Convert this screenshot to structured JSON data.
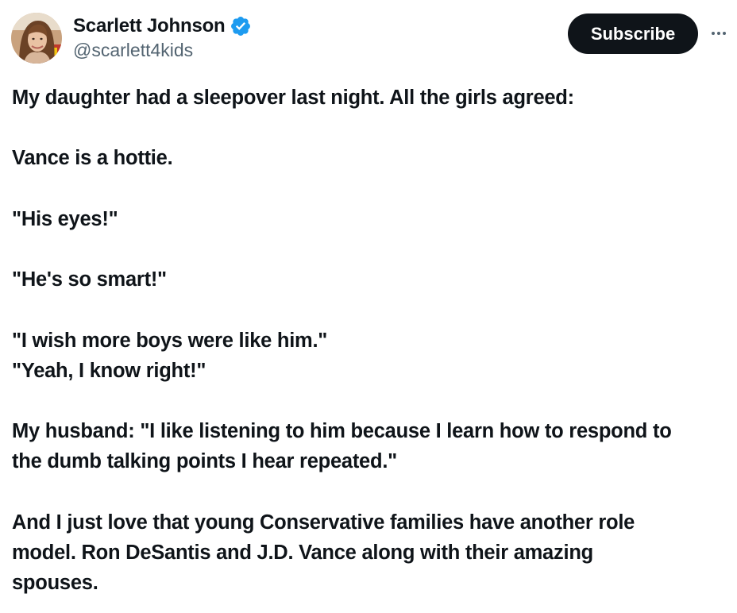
{
  "author": {
    "display_name": "Scarlett Johnson",
    "handle": "@scarlett4kids",
    "verified": true,
    "avatar_icon": "profile-photo"
  },
  "actions": {
    "subscribe_label": "Subscribe",
    "more_icon": "more-horizontal-icon"
  },
  "tweet": {
    "paragraphs": [
      [
        "My daughter had a sleepover last night. All the girls agreed:"
      ],
      [
        "Vance is a hottie."
      ],
      [
        "\"His eyes!\""
      ],
      [
        "\"He's so smart!\""
      ],
      [
        "\"I wish more boys were like him.\"",
        "\"Yeah, I know right!\""
      ],
      [
        "My husband: \"I like listening to him because I learn how to respond to",
        "the dumb talking points I hear repeated.\""
      ],
      [
        "And I just love that young Conservative families have another role",
        "model. Ron DeSantis and J.D. Vance along with their amazing",
        "spouses."
      ]
    ]
  },
  "colors": {
    "text_primary": "#0f1419",
    "text_secondary": "#536471",
    "verified_blue": "#1d9bf0",
    "button_bg": "#0f1419",
    "button_text": "#ffffff"
  }
}
